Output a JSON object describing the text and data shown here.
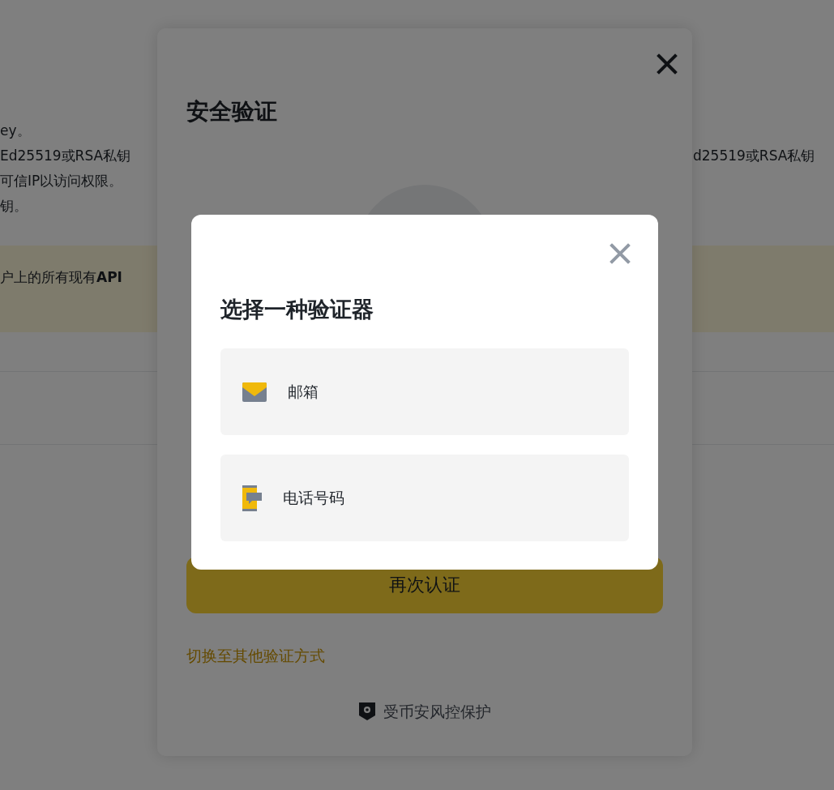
{
  "background_page": {
    "description_lines": [
      "ey。",
      "Ed25519或RSA私钥",
      "可信IP以访问权限。",
      "钥。"
    ],
    "right_line": "d25519或RSA私钥",
    "warning_banner": "户上的所有现有**API**"
  },
  "security_dialog": {
    "title": "安全验证",
    "button": "再次认证",
    "switch_link": "切换至其他验证方式",
    "footer": "受币安风控保护"
  },
  "authenticator_dialog": {
    "title": "选择一种验证器",
    "options": [
      {
        "kind": "email",
        "label": "邮箱"
      },
      {
        "kind": "phone",
        "label": "电话号码"
      }
    ]
  }
}
